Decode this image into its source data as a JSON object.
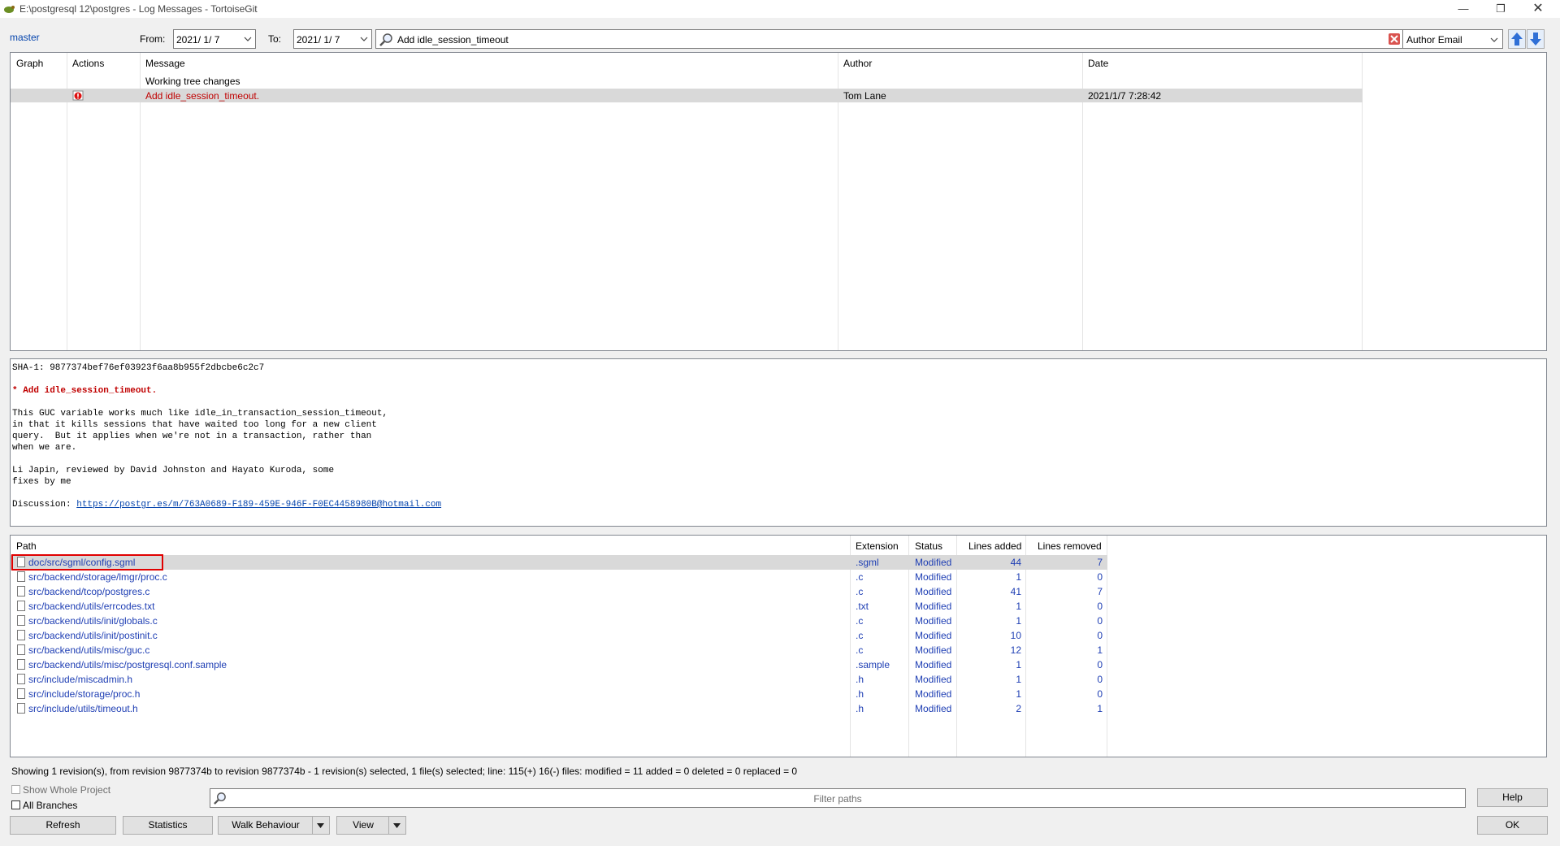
{
  "window": {
    "title": "E:\\postgresql 12\\postgres - Log Messages - TortoiseGit",
    "controls": [
      "minimize",
      "restore",
      "close"
    ]
  },
  "toolbar": {
    "branch": "master",
    "from_label": "From:",
    "from_date": "2021/ 1/ 7",
    "to_label": "To:",
    "to_date": "2021/ 1/ 7",
    "search_text": "Add idle_session_timeout",
    "filter_field": "Author Email"
  },
  "log_list": {
    "columns": [
      "Graph",
      "Actions",
      "Message",
      "Author",
      "Date"
    ],
    "working_tree": "Working tree changes",
    "rows": [
      {
        "message": "Add idle_session_timeout.",
        "author": "Tom Lane",
        "date": "2021/1/7 7:28:42",
        "selected": true
      }
    ]
  },
  "commit_message": {
    "sha": "SHA-1: 9877374bef76ef03923f6aa8b955f2dbcbe6c2c7",
    "subject": "* Add idle_session_timeout.",
    "body_lines": [
      "This GUC variable works much like idle_in_transaction_session_timeout,",
      "in that it kills sessions that have waited too long for a new client",
      "query.  But it applies when we're not in a transaction, rather than",
      "when we are."
    ],
    "credits_lines": [
      "Li Japin, reviewed by David Johnston and Hayato Kuroda, some",
      "fixes by me"
    ],
    "discussion_label": "Discussion: ",
    "discussion_url": "https://postgr.es/m/763A0689-F189-459E-946F-F0EC4458980B@hotmail.com"
  },
  "file_list": {
    "columns": [
      "Path",
      "Extension",
      "Status",
      "Lines added",
      "Lines removed"
    ],
    "rows": [
      {
        "path": "doc/src/sgml/config.sgml",
        "ext": ".sgml",
        "status": "Modified",
        "added": "44",
        "removed": "7"
      },
      {
        "path": "src/backend/storage/lmgr/proc.c",
        "ext": ".c",
        "status": "Modified",
        "added": "1",
        "removed": "0"
      },
      {
        "path": "src/backend/tcop/postgres.c",
        "ext": ".c",
        "status": "Modified",
        "added": "41",
        "removed": "7"
      },
      {
        "path": "src/backend/utils/errcodes.txt",
        "ext": ".txt",
        "status": "Modified",
        "added": "1",
        "removed": "0"
      },
      {
        "path": "src/backend/utils/init/globals.c",
        "ext": ".c",
        "status": "Modified",
        "added": "1",
        "removed": "0"
      },
      {
        "path": "src/backend/utils/init/postinit.c",
        "ext": ".c",
        "status": "Modified",
        "added": "10",
        "removed": "0"
      },
      {
        "path": "src/backend/utils/misc/guc.c",
        "ext": ".c",
        "status": "Modified",
        "added": "12",
        "removed": "1"
      },
      {
        "path": "src/backend/utils/misc/postgresql.conf.sample",
        "ext": ".sample",
        "status": "Modified",
        "added": "1",
        "removed": "0"
      },
      {
        "path": "src/include/miscadmin.h",
        "ext": ".h",
        "status": "Modified",
        "added": "1",
        "removed": "0"
      },
      {
        "path": "src/include/storage/proc.h",
        "ext": ".h",
        "status": "Modified",
        "added": "1",
        "removed": "0"
      },
      {
        "path": "src/include/utils/timeout.h",
        "ext": ".h",
        "status": "Modified",
        "added": "2",
        "removed": "1"
      }
    ]
  },
  "status_line": "Showing 1 revision(s), from revision 9877374b to revision 9877374b - 1 revision(s) selected, 1 file(s) selected; line: 115(+) 16(-) files: modified = 11 added = 0 deleted = 0 replaced = 0",
  "bottom": {
    "show_whole_project": "Show Whole Project",
    "all_branches": "All Branches",
    "filter_placeholder": "Filter paths",
    "help": "Help",
    "ok": "OK",
    "refresh": "Refresh",
    "statistics": "Statistics",
    "walk_behaviour": "Walk Behaviour",
    "view": "View"
  },
  "colors": {
    "selection": "#d9d9d9",
    "accent_red": "#c00000",
    "file_blue": "#1f3fb4",
    "highlight_box": "#e00000"
  }
}
